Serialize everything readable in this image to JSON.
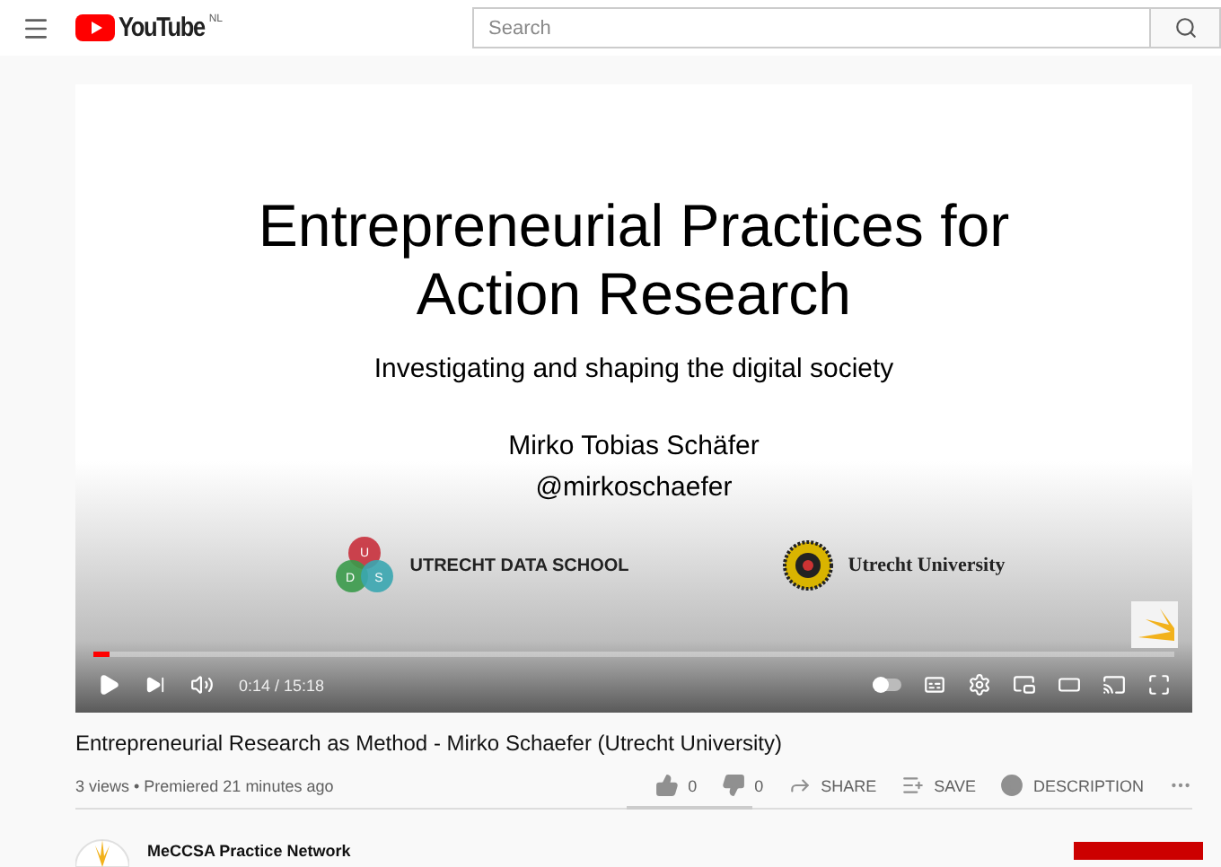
{
  "header": {
    "logo_text": "YouTube",
    "region": "NL",
    "search": {
      "placeholder": "Search"
    }
  },
  "slide": {
    "title_lines": [
      "Entrepreneurial Practices for",
      "Action Research"
    ],
    "subtitle": "Investigating and shaping the digital society",
    "author": "Mirko Tobias Schäfer",
    "handle": "@mirkoschaefer",
    "logos": [
      {
        "kind": "venn",
        "letters": [
          "U",
          "D",
          "S"
        ],
        "label": "UTRECHT DATA SCHOOL"
      },
      {
        "kind": "seal",
        "label": "Utrecht University"
      }
    ]
  },
  "player": {
    "progress": {
      "level": 0.015
    },
    "time": "0:14 / 15:18",
    "autoplay": {
      "on": false
    }
  },
  "video": {
    "title": "Entrepreneurial Research as Method - Mirko Schaefer (Utrecht University)",
    "meta": "3 views • Premiered 21 minutes ago",
    "actions": [
      {
        "kind": "like",
        "label": "0"
      },
      {
        "kind": "dislike",
        "label": "0"
      },
      {
        "kind": "share",
        "label": "SHARE"
      },
      {
        "kind": "save",
        "label": "SAVE"
      },
      {
        "kind": "description",
        "label": "DESCRIPTION"
      },
      {
        "kind": "more"
      }
    ]
  },
  "channel": {
    "name": "MeCCSA Practice Network"
  }
}
